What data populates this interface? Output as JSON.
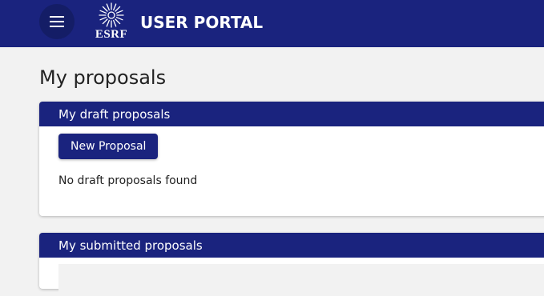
{
  "header": {
    "title": "USER PORTAL",
    "logo_text": "ESRF",
    "menu_icon": "hamburger-menu-icon",
    "background_color": "#1a237e"
  },
  "page": {
    "title": "My proposals"
  },
  "draft": {
    "title": "My draft proposals",
    "new_button_label": "New Proposal",
    "empty_message": "No draft proposals found"
  },
  "submitted": {
    "title": "My submitted proposals"
  }
}
